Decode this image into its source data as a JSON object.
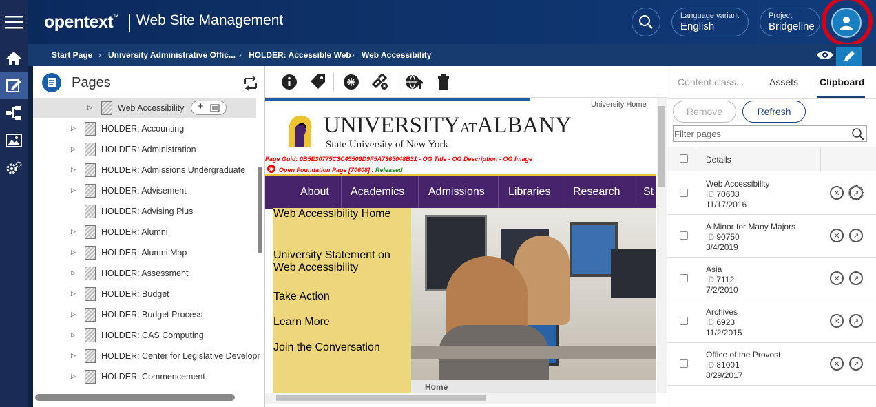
{
  "sidebar": {
    "items": [
      {
        "name": "menu-icon"
      },
      {
        "name": "home-icon"
      },
      {
        "name": "edit-icon"
      },
      {
        "name": "structure-icon"
      },
      {
        "name": "assets-icon"
      },
      {
        "name": "settings-icon"
      }
    ]
  },
  "header": {
    "logo": "opentext",
    "logo_tm": "™",
    "app_title": "Web Site Management",
    "language_label": "Language variant",
    "language_value": "English",
    "project_label": "Project",
    "project_value": "Bridgeline"
  },
  "breadcrumb": [
    "Start Page",
    "University Administrative Offic...",
    "HOLDER: Accessible Web",
    "Web Accessibility"
  ],
  "pages_panel": {
    "title": "Pages",
    "selected": "Web Accessibility",
    "items": [
      "HOLDER: Accounting",
      "HOLDER: Administration",
      "HOLDER: Admissions Undergraduate",
      "HOLDER: Advisement",
      "HOLDER: Advising Plus",
      "HOLDER: Alumni",
      "HOLDER: Alumni Map",
      "HOLDER: Assessment",
      "HOLDER: Budget",
      "HOLDER: Budget Process",
      "HOLDER: CAS Computing",
      "HOLDER: Center for Legislative Developm",
      "HOLDER: Commencement"
    ]
  },
  "preview": {
    "university_home_link": "University Home",
    "brand_main": "UNIVERSITY",
    "brand_at": "AT",
    "brand_albany": "ALBANY",
    "brand_sub": "State University of New York",
    "page_guid": "Page Guid: 0B5E30775C3C45509D9F5A7365048B31 - OG Title - OG Description - OG Image",
    "foundation_text": "Open Foundation Page [70608] : ",
    "foundation_status": "Released",
    "nav": [
      "About",
      "Academics",
      "Admissions",
      "Libraries",
      "Research",
      "St"
    ],
    "menu": [
      "Web Accessibility Home",
      "University Statement on Web Accessibility",
      "Take Action",
      "Learn More",
      "Join the Conversation"
    ],
    "footer_home": "Home"
  },
  "right_panel": {
    "tabs": [
      "Content class...",
      "Assets",
      "Clipboard"
    ],
    "active_tab": "Clipboard",
    "remove_label": "Remove",
    "refresh_label": "Refresh",
    "filter_placeholder": "Filter pages",
    "details_header": "Details",
    "id_label": "ID",
    "rows": [
      {
        "name": "Web Accessibility",
        "id": "70608",
        "date": "11/17/2016"
      },
      {
        "name": "A Minor for Many Majors",
        "id": "90750",
        "date": "3/4/2019"
      },
      {
        "name": "Asia",
        "id": "7112",
        "date": "7/2/2010"
      },
      {
        "name": "Archives",
        "id": "6923",
        "date": "11/2/2015"
      },
      {
        "name": "Office of the Provost",
        "id": "81001",
        "date": "8/29/2017"
      }
    ]
  },
  "colors": {
    "nav_purple": "#46236b",
    "menu_gold": "#eed67a",
    "accent_blue": "#1f3f7a",
    "highlight_red": "#d0021b"
  }
}
